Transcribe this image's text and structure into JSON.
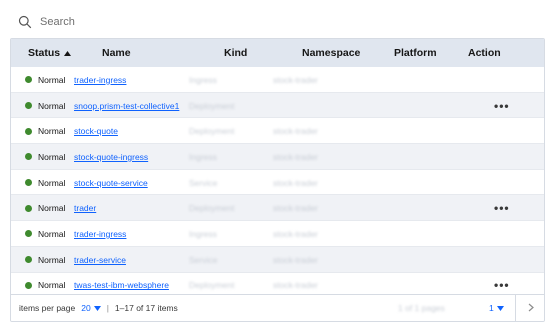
{
  "search": {
    "placeholder": "Search"
  },
  "table": {
    "headers": {
      "status": "Status",
      "name": "Name",
      "kind": "Kind",
      "namespace": "Namespace",
      "platform": "Platform",
      "action": "Action"
    },
    "rows": [
      {
        "status": "Normal",
        "name": "trader-ingress",
        "kind": "Ingress",
        "namespace": "stock-trader",
        "action": ""
      },
      {
        "status": "Normal",
        "name": "snoop.prism-test-collective1",
        "kind": "Deployment",
        "namespace": "",
        "action": "•••"
      },
      {
        "status": "Normal",
        "name": "stock-quote",
        "kind": "Deployment",
        "namespace": "stock-trader",
        "action": ""
      },
      {
        "status": "Normal",
        "name": "stock-quote-ingress",
        "kind": "Ingress",
        "namespace": "stock-trader",
        "action": ""
      },
      {
        "status": "Normal",
        "name": "stock-quote-service",
        "kind": "Service",
        "namespace": "stock-trader",
        "action": ""
      },
      {
        "status": "Normal",
        "name": "trader",
        "kind": "Deployment",
        "namespace": "stock-trader",
        "action": "•••"
      },
      {
        "status": "Normal",
        "name": "trader-ingress",
        "kind": "Ingress",
        "namespace": "stock-trader",
        "action": ""
      },
      {
        "status": "Normal",
        "name": "trader-service",
        "kind": "Service",
        "namespace": "stock-trader",
        "action": ""
      },
      {
        "status": "Normal",
        "name": "twas-test-ibm-websphere",
        "kind": "Deployment",
        "namespace": "stock-trader",
        "action": "•••"
      }
    ]
  },
  "footer": {
    "items_per_page_label": "items per page",
    "items_per_page_value": "20",
    "range_text": "1–17 of 17 items",
    "page_count_text": "1 of 1 pages",
    "page_value": "1"
  },
  "colors": {
    "status_normal": "#3f8a2e",
    "link": "#0f62fe",
    "header_bg": "#e0e6ef"
  }
}
